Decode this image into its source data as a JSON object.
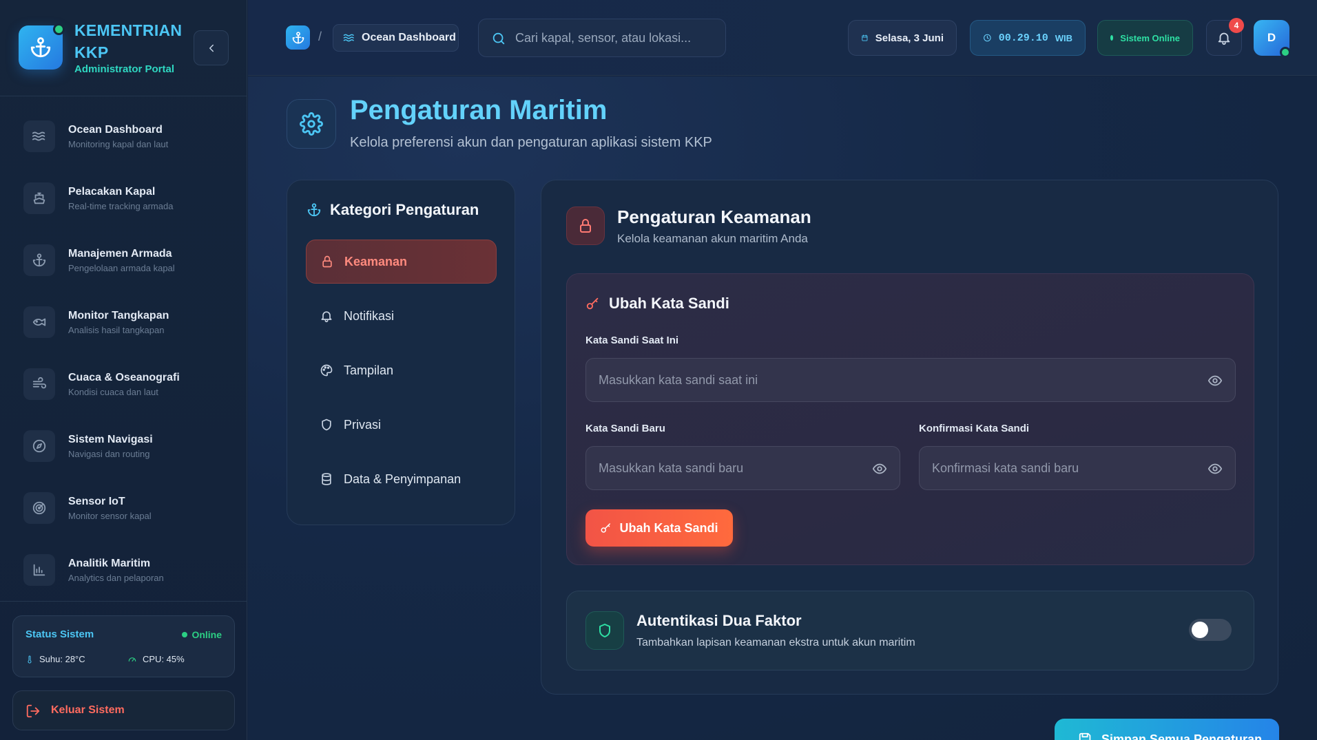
{
  "brand": {
    "title": "KEMENTRIAN KKP",
    "subtitle": "Administrator Portal"
  },
  "sidebar": {
    "items": [
      {
        "label": "Ocean Dashboard",
        "desc": "Monitoring kapal dan laut",
        "icon": "waves-icon"
      },
      {
        "label": "Pelacakan Kapal",
        "desc": "Real-time tracking armada",
        "icon": "ship-icon"
      },
      {
        "label": "Manajemen Armada",
        "desc": "Pengelolaan armada kapal",
        "icon": "anchor-icon"
      },
      {
        "label": "Monitor Tangkapan",
        "desc": "Analisis hasil tangkapan",
        "icon": "fish-icon"
      },
      {
        "label": "Cuaca & Oseanografi",
        "desc": "Kondisi cuaca dan laut",
        "icon": "wind-icon"
      },
      {
        "label": "Sistem Navigasi",
        "desc": "Navigasi dan routing",
        "icon": "compass-icon"
      },
      {
        "label": "Sensor IoT",
        "desc": "Monitor sensor kapal",
        "icon": "radar-icon"
      },
      {
        "label": "Analitik Maritim",
        "desc": "Analytics dan pelaporan",
        "icon": "bar-chart-icon"
      }
    ],
    "status": {
      "title": "Status Sistem",
      "online": "Online",
      "temp": "Suhu: 28°C",
      "cpu": "CPU: 45%"
    },
    "logout": "Keluar Sistem"
  },
  "topbar": {
    "breadcrumb_sep": "/",
    "breadcrumb": "Ocean Dashboard",
    "search_placeholder": "Cari kapal, sensor, atau lokasi...",
    "date": "Selasa, 3 Juni",
    "time": "00.29.10",
    "time_zone": "WIB",
    "system_status": "Sistem Online",
    "notif_count": "4",
    "avatar_initial": "D"
  },
  "page": {
    "title": "Pengaturan Maritim",
    "subtitle": "Kelola preferensi akun dan pengaturan aplikasi sistem KKP"
  },
  "categories": {
    "title": "Kategori Pengaturan",
    "items": [
      {
        "label": "Keamanan",
        "icon": "lock-icon",
        "active": true
      },
      {
        "label": "Notifikasi",
        "icon": "bell-icon",
        "active": false
      },
      {
        "label": "Tampilan",
        "icon": "palette-icon",
        "active": false
      },
      {
        "label": "Privasi",
        "icon": "shield-icon",
        "active": false
      },
      {
        "label": "Data & Penyimpanan",
        "icon": "database-icon",
        "active": false
      }
    ]
  },
  "security": {
    "title": "Pengaturan Keamanan",
    "subtitle": "Kelola keamanan akun maritim Anda",
    "password": {
      "title": "Ubah Kata Sandi",
      "current_label": "Kata Sandi Saat Ini",
      "current_placeholder": "Masukkan kata sandi saat ini",
      "new_label": "Kata Sandi Baru",
      "new_placeholder": "Masukkan kata sandi baru",
      "confirm_label": "Konfirmasi Kata Sandi",
      "confirm_placeholder": "Konfirmasi kata sandi baru",
      "button": "Ubah Kata Sandi"
    },
    "two_factor": {
      "title": "Autentikasi Dua Faktor",
      "subtitle": "Tambahkan lapisan keamanan ekstra untuk akun maritim",
      "enabled": false
    }
  },
  "save_button": "Simpan Semua Pengaturan",
  "colors": {
    "accent": "#4cc6f4",
    "danger": "#ff6b5f",
    "success": "#2ccf84",
    "background": "#13233c"
  }
}
